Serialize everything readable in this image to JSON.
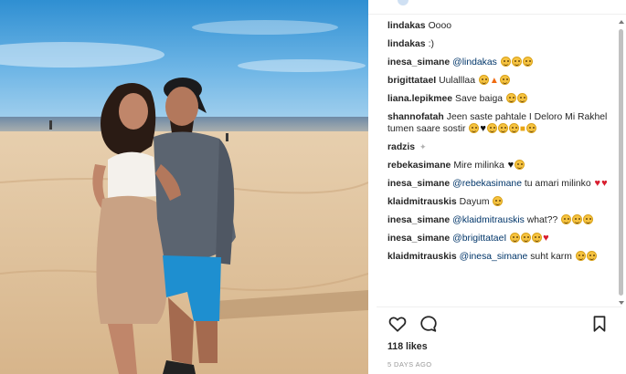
{
  "post": {
    "likes": "118 likes",
    "timestamp": "5 DAYS AGO"
  },
  "comments": [
    {
      "user": "lindakas",
      "parts": [
        {
          "t": "text",
          "v": "Oooo"
        }
      ]
    },
    {
      "user": "lindakas",
      "parts": [
        {
          "t": "text",
          "v": ":)"
        }
      ]
    },
    {
      "user": "inesa_simane",
      "parts": [
        {
          "t": "mention",
          "v": "@lindakas"
        },
        {
          "t": "emoji",
          "v": "grin-emoji"
        },
        {
          "t": "emoji",
          "v": "grin-emoji"
        },
        {
          "t": "emoji",
          "v": "wink-emoji"
        }
      ]
    },
    {
      "user": "brigittataeI",
      "parts": [
        {
          "t": "text",
          "v": "Uulalllaa"
        },
        {
          "t": "emoji",
          "v": "star-eyes-emoji"
        },
        {
          "t": "flame",
          "v": "fire-emoji"
        },
        {
          "t": "emoji",
          "v": "grin-emoji"
        }
      ]
    },
    {
      "user": "liana.lepikmee",
      "parts": [
        {
          "t": "text",
          "v": "Save baiga"
        },
        {
          "t": "emoji",
          "v": "smile-emoji"
        },
        {
          "t": "emoji",
          "v": "smile-emoji"
        }
      ]
    },
    {
      "user": "shannofatah",
      "parts": [
        {
          "t": "text",
          "v": "Jeen saste pahtale I Deloro Mi Rakhel tumen saare sostir"
        },
        {
          "t": "emoji",
          "v": "smile-emoji"
        },
        {
          "t": "heart-black",
          "v": "black-heart-emoji"
        },
        {
          "t": "emoji",
          "v": "hug-emoji"
        },
        {
          "t": "emoji",
          "v": "grin-emoji"
        },
        {
          "t": "emoji",
          "v": "grin-emoji"
        },
        {
          "t": "thumb",
          "v": "thumbs-up-emoji"
        },
        {
          "t": "emoji",
          "v": "halo-emoji"
        }
      ]
    },
    {
      "user": "radzis",
      "parts": [
        {
          "t": "sparkle",
          "v": "sparkle-emoji"
        }
      ]
    },
    {
      "user": "rebekasimane",
      "parts": [
        {
          "t": "text",
          "v": "Mire milinka"
        },
        {
          "t": "heart-black",
          "v": "black-heart-emoji"
        },
        {
          "t": "emoji",
          "v": "cat-emoji"
        }
      ]
    },
    {
      "user": "inesa_simane",
      "parts": [
        {
          "t": "mention",
          "v": "@rebekasimane"
        },
        {
          "t": "text",
          "v": "tu amari milinko"
        },
        {
          "t": "heart",
          "v": "red-heart-emoji"
        },
        {
          "t": "heart",
          "v": "red-heart-emoji"
        }
      ]
    },
    {
      "user": "klaidmitrauskis",
      "parts": [
        {
          "t": "text",
          "v": "Dayum"
        },
        {
          "t": "emoji",
          "v": "sweat-smile-emoji"
        }
      ]
    },
    {
      "user": "inesa_simane",
      "parts": [
        {
          "t": "mention",
          "v": "@klaidmitrauskis"
        },
        {
          "t": "text",
          "v": "what??"
        },
        {
          "t": "emoji",
          "v": "grin-emoji"
        },
        {
          "t": "emoji",
          "v": "grin-emoji"
        },
        {
          "t": "emoji",
          "v": "grin-emoji"
        }
      ]
    },
    {
      "user": "inesa_simane",
      "parts": [
        {
          "t": "mention",
          "v": "@brigittataeI"
        },
        {
          "t": "emoji",
          "v": "kiss-emoji"
        },
        {
          "t": "emoji",
          "v": "kiss-emoji"
        },
        {
          "t": "emoji",
          "v": "grin-emoji"
        },
        {
          "t": "heart",
          "v": "red-heart-emoji"
        }
      ]
    },
    {
      "user": "klaidmitrauskis",
      "parts": [
        {
          "t": "mention",
          "v": "@inesa_simane"
        },
        {
          "t": "text",
          "v": "suht karm"
        },
        {
          "t": "emoji",
          "v": "grin-emoji"
        },
        {
          "t": "emoji",
          "v": "grin-emoji"
        }
      ]
    }
  ],
  "icons": {
    "like": "heart-outline-icon",
    "comment": "speech-bubble-icon",
    "save": "bookmark-icon"
  },
  "colors": {
    "mention": "#003569",
    "meta": "#999999",
    "text": "#262626"
  }
}
